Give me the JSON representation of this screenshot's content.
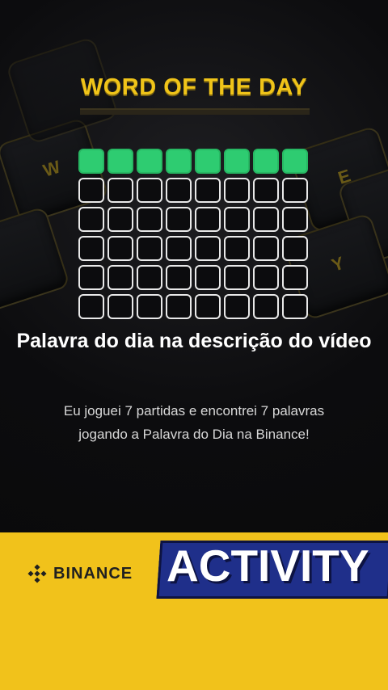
{
  "game": {
    "title": "WORD OF THE DAY",
    "grid": {
      "rows": 6,
      "cols": 8,
      "filled_rows": 1,
      "filled_color": "#2ecc71"
    }
  },
  "content": {
    "headline": "Palavra do dia na descrição do vídeo",
    "description": "Eu joguei 7 partidas e encontrei 7 palavras jogando a Palavra do Dia na Binance!"
  },
  "footer": {
    "brand": "BINANCE",
    "brand_icon": "binance-logo-icon",
    "banner": "ACTIVITY"
  },
  "background_keys": [
    "W",
    "E",
    "Y"
  ],
  "colors": {
    "accent_yellow": "#f1c21b",
    "title_yellow": "#f0c419",
    "banner_blue": "#1f2f8a",
    "tile_green": "#2ecc71"
  }
}
